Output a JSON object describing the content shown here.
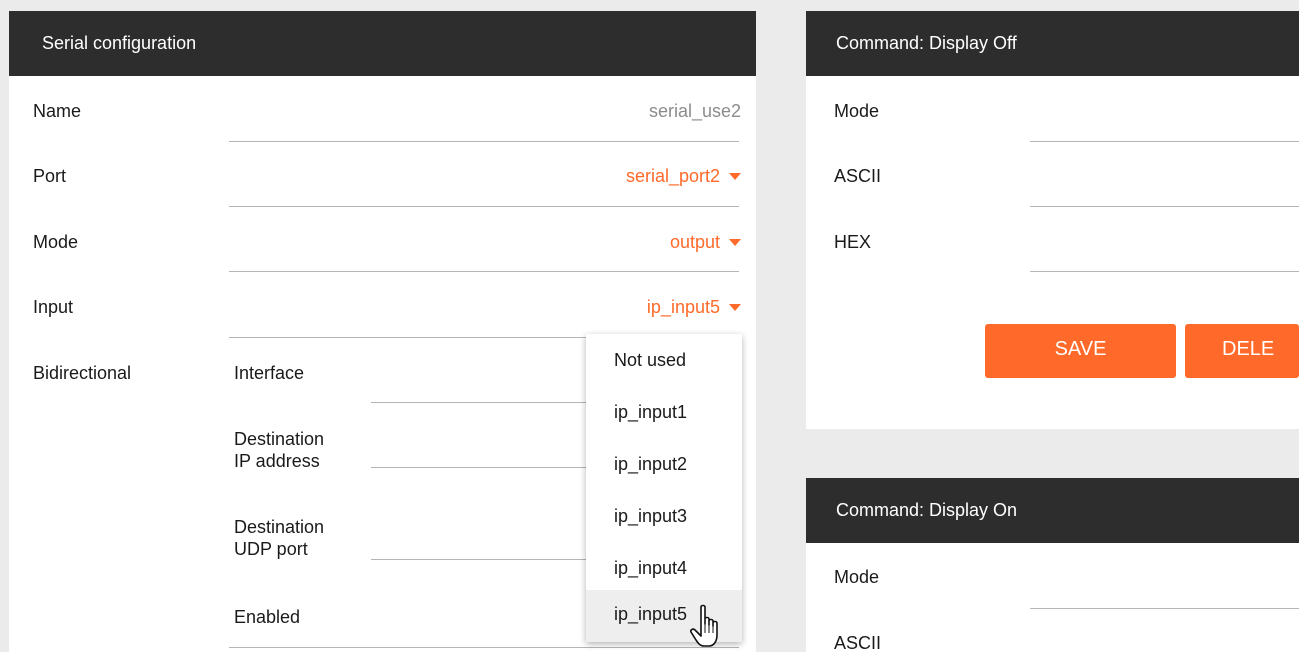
{
  "serial_config": {
    "header": "Serial configuration",
    "name_label": "Name",
    "name_value": "serial_use2",
    "port_label": "Port",
    "port_value": "serial_port2",
    "mode_label": "Mode",
    "mode_value": "output",
    "input_label": "Input",
    "input_value": "ip_input5",
    "bidirectional_label": "Bidirectional",
    "interface_label": "Interface",
    "dest_ip_label": "Destination\nIP address",
    "dest_udp_label": "Destination\nUDP port",
    "enabled_label": "Enabled"
  },
  "input_dropdown": {
    "options": [
      "Not used",
      "ip_input1",
      "ip_input2",
      "ip_input3",
      "ip_input4",
      "ip_input5"
    ],
    "hovered": "ip_input5"
  },
  "display_off": {
    "header": "Command: Display Off",
    "mode_label": "Mode",
    "ascii_label": "ASCII",
    "hex_label": "HEX",
    "save_label": "SAVE",
    "delete_label": "DELE"
  },
  "display_on": {
    "header": "Command: Display On",
    "mode_label": "Mode",
    "ascii_label": "ASCII"
  },
  "colors": {
    "accent": "#ff6a2a",
    "header_bg": "#2d2d2d",
    "page_bg": "#ebebeb"
  },
  "icons": [
    "caret-down-icon",
    "hand-pointer-cursor-icon"
  ]
}
